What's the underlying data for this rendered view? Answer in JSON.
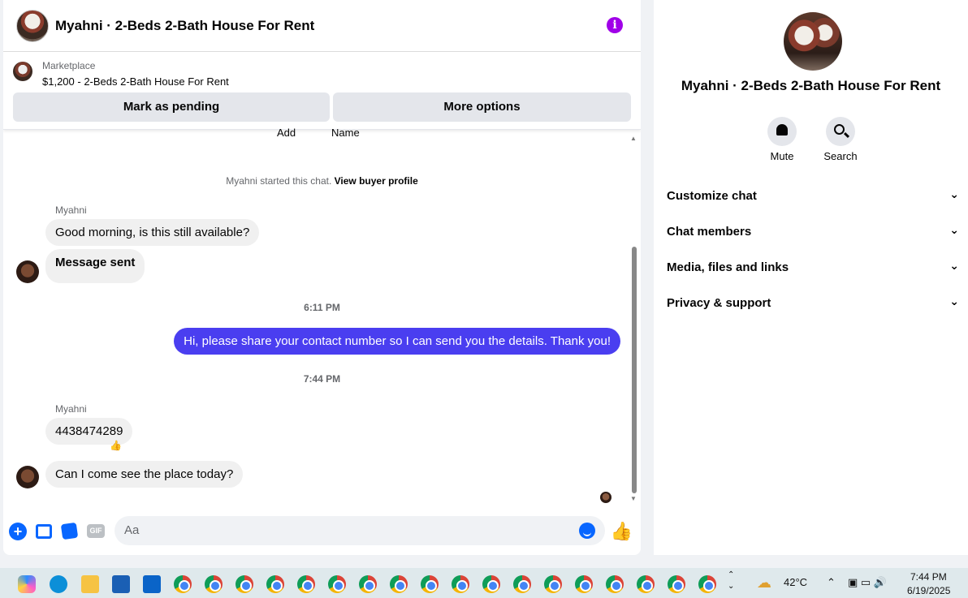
{
  "header": {
    "title": "Myahni · 2-Beds 2-Bath House For Rent",
    "info_icon": "info-icon"
  },
  "listing": {
    "label": "Marketplace",
    "price_title": "$1,200 - 2-Beds 2-Bath House For Rent",
    "pending_label": "Mark as pending",
    "more_label": "More options"
  },
  "cut_off": {
    "left": "Add",
    "right": "Name"
  },
  "system": {
    "started": "Myahni started this chat.",
    "profile_link": "View buyer profile"
  },
  "messages": {
    "sender1": "Myahni",
    "m1": "Good morning, is this still available?",
    "m2": "Message sent",
    "time1": "6:11 PM",
    "mine1": "Hi, please share your contact number so I can send you the details. Thank you!",
    "time2": "7:44 PM",
    "sender2": "Myahni",
    "m3": "4438474289",
    "m3_reaction": "👍",
    "m4": "Can I come see the place today?"
  },
  "composer": {
    "placeholder": "Aa",
    "gif_label": "GIF"
  },
  "side": {
    "title": "Myahni · 2-Beds 2-Bath House For Rent",
    "mute_label": "Mute",
    "search_label": "Search",
    "sections": [
      "Customize chat",
      "Chat members",
      "Media, files and links",
      "Privacy & support"
    ]
  },
  "taskbar": {
    "temp": "42°C",
    "time": "7:44 PM",
    "date": "6/19/2025"
  },
  "colors": {
    "my_bubble": "#4a3ef0",
    "accent": "#0866ff",
    "info": "#a000e8"
  }
}
